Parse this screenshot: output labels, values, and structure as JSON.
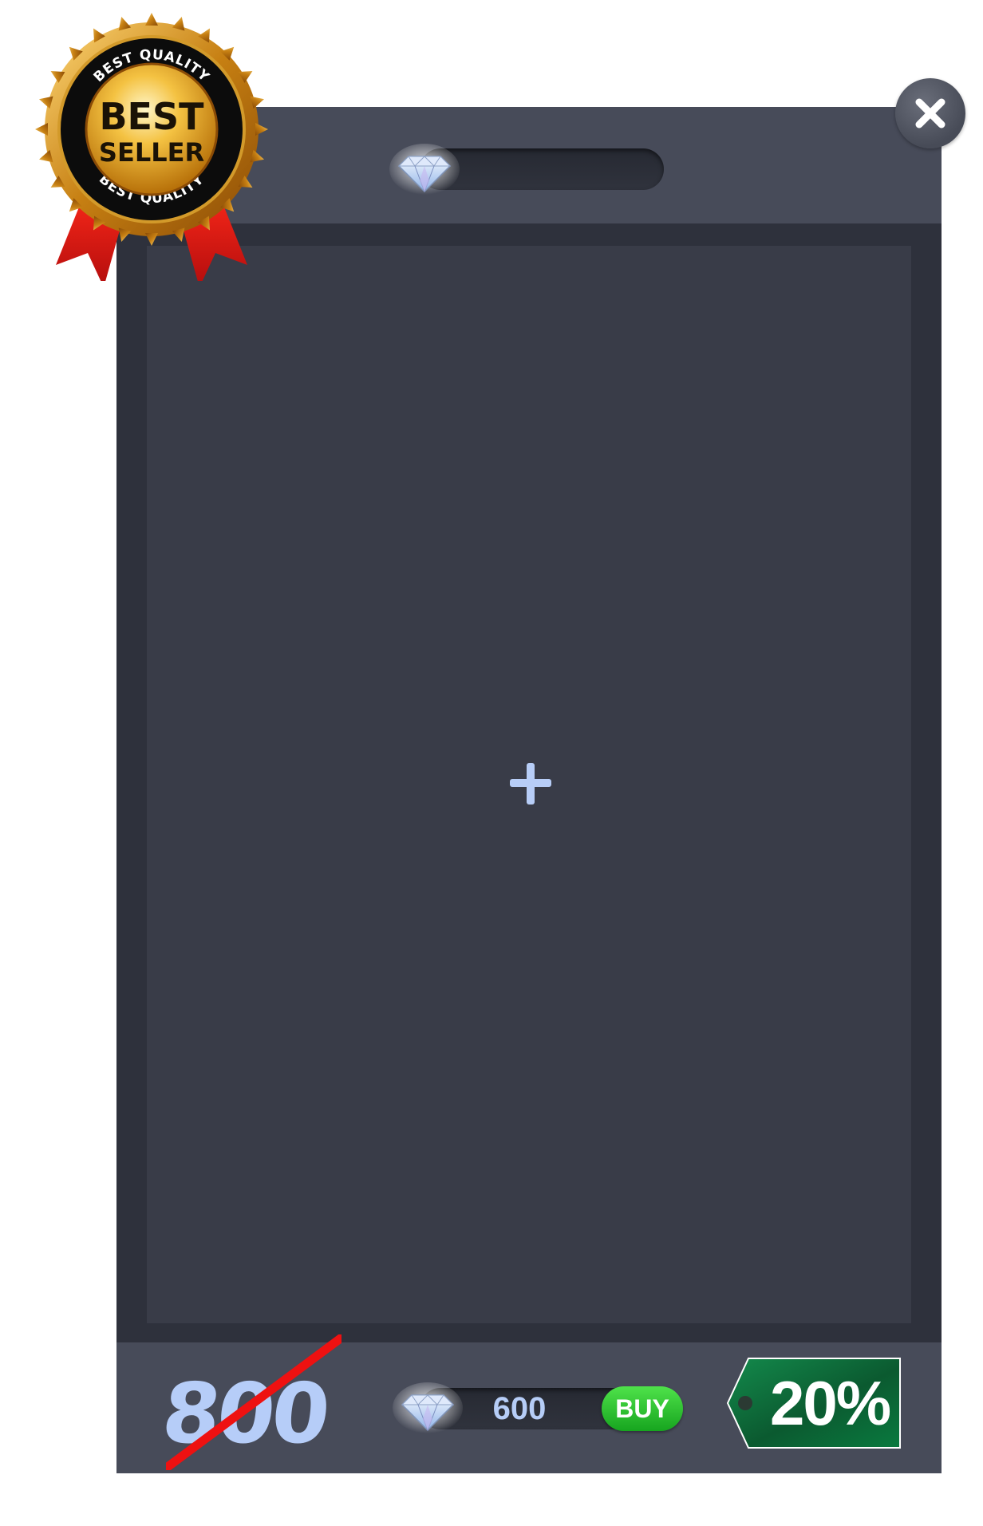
{
  "badge": {
    "line1": "BEST",
    "line2": "SELLER",
    "ring_text": "BEST QUALITY"
  },
  "close_button": {
    "icon": "close-icon"
  },
  "header": {
    "gem_icon": "diamond-icon",
    "gem_balance": ""
  },
  "content": {
    "add_icon": "plus-icon"
  },
  "footer": {
    "old_price": "800",
    "gem_icon": "diamond-icon",
    "price": "600",
    "buy_label": "BUY",
    "discount": "20%"
  },
  "colors": {
    "panel": "#474b59",
    "frame": "#2e313c",
    "content": "#393c48",
    "accent_text": "#b6cdf7",
    "buy_green": "#22b52a",
    "tag_green": "#0b6a3a",
    "strike_red": "#ee1111"
  }
}
